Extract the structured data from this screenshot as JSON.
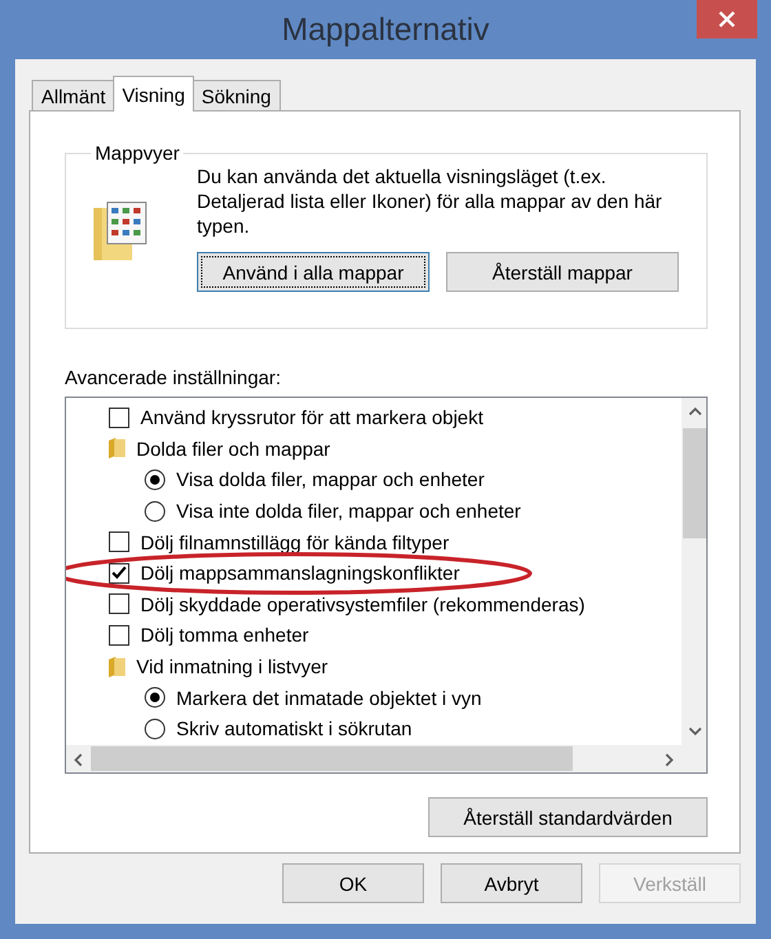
{
  "window": {
    "title": "Mappalternativ"
  },
  "tabs": [
    {
      "label": "Allmänt",
      "selected": false
    },
    {
      "label": "Visning",
      "selected": true
    },
    {
      "label": "Sökning",
      "selected": false
    }
  ],
  "folder_views": {
    "title": "Mappvyer",
    "description": "Du kan använda det aktuella visningsläget (t.ex. Detaljerad lista eller Ikoner) för alla mappar av den här typen.",
    "buttons": [
      {
        "label": "Använd i alla mappar",
        "focused": true
      },
      {
        "label": "Återställ mappar",
        "focused": false
      }
    ]
  },
  "advanced": {
    "label": "Avancerade inställningar:",
    "items": [
      {
        "kind": "checkbox",
        "label": "Använd kryssrutor för att markera objekt",
        "checked": false,
        "circled": false
      },
      {
        "kind": "folder",
        "label": "Dolda filer och mappar",
        "children": [
          {
            "kind": "radio",
            "label": "Visa dolda filer, mappar och enheter",
            "selected": true
          },
          {
            "kind": "radio",
            "label": "Visa inte dolda filer, mappar och enheter",
            "selected": false
          }
        ]
      },
      {
        "kind": "checkbox",
        "label": "Dölj filnamnstillägg för kända filtyper",
        "checked": false,
        "circled": false
      },
      {
        "kind": "checkbox",
        "label": "Dölj mappsammanslagningskonflikter",
        "checked": true,
        "circled": true
      },
      {
        "kind": "checkbox",
        "label": "Dölj skyddade operativsystemfiler (rekommenderas)",
        "checked": false,
        "circled": false
      },
      {
        "kind": "checkbox",
        "label": "Dölj tomma enheter",
        "checked": false,
        "circled": false
      },
      {
        "kind": "folder",
        "label": "Vid inmatning i listvyer",
        "children": [
          {
            "kind": "radio",
            "label": "Markera det inmatade objektet i vyn",
            "selected": true
          },
          {
            "kind": "radio",
            "label": "Skriv automatiskt i sökrutan",
            "selected": false
          }
        ]
      }
    ],
    "restore_button": "Återställ standardvärden"
  },
  "buttons": [
    {
      "label": "OK",
      "disabled": false
    },
    {
      "label": "Avbryt",
      "disabled": false
    },
    {
      "label": "Verkställ",
      "disabled": true
    }
  ]
}
